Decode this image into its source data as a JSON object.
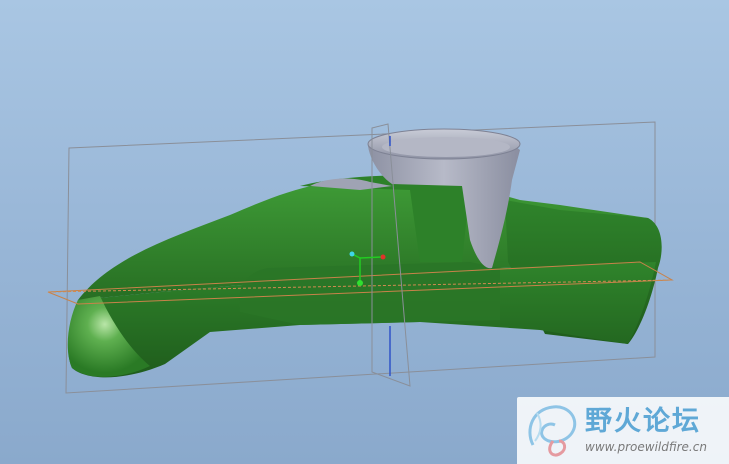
{
  "viewport": {
    "background_top": "#a9c6e3",
    "background_bottom": "#8aa9cc"
  },
  "model": {
    "body_color": "#2f7d2a",
    "part_color": "#9fa3b4",
    "datum_plane_color": "#8a8f99",
    "datum_plane_accent": "#c8824a"
  },
  "icons": {
    "csys": "coordinate-system-icon",
    "axis": "datum-axis-icon",
    "logo": "proewildfire-logo-icon"
  },
  "watermark": {
    "title": "野火论坛",
    "url": "www.proewildfire.cn"
  }
}
